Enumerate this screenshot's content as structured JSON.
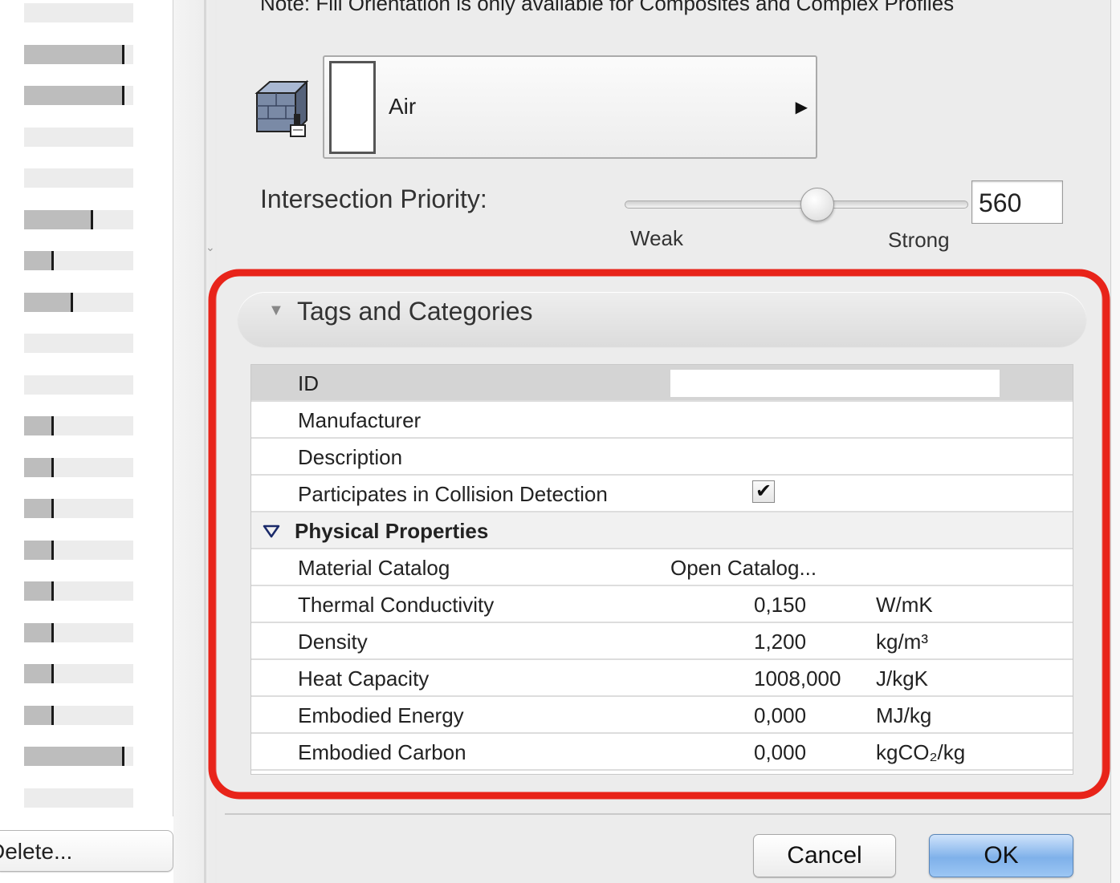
{
  "note": {
    "text": "Note: Fill Orientation is only available for Composites and Complex Profiles"
  },
  "fill": {
    "icon": "surface-brush-icon",
    "name": "Air",
    "arrow": "▶"
  },
  "priority": {
    "label": "Intersection Priority:",
    "value": "560",
    "slider_fraction": 0.56,
    "weak_label": "Weak",
    "strong_label": "Strong"
  },
  "tags": {
    "title": "Tags and Categories",
    "rows": {
      "id": {
        "label": "ID",
        "value": ""
      },
      "manufacturer": {
        "label": "Manufacturer"
      },
      "description": {
        "label": "Description"
      },
      "collision": {
        "label": "Participates in Collision Detection",
        "checked": true,
        "check_glyph": "✔"
      }
    },
    "physical": {
      "title": "Physical Properties",
      "catalog": {
        "label": "Material Catalog",
        "link": "Open Catalog..."
      },
      "thermal": {
        "label": "Thermal Conductivity",
        "value": "0,150",
        "unit": "W/mK"
      },
      "density": {
        "label": "Density",
        "value": "1,200",
        "unit": "kg/m³"
      },
      "heat": {
        "label": "Heat Capacity",
        "value": "1008,000",
        "unit": "J/kgK"
      },
      "energy": {
        "label": "Embodied Energy",
        "value": "0,000",
        "unit": "MJ/kg"
      },
      "carbon": {
        "label": "Embodied Carbon",
        "value": "0,000",
        "unit": "kgCO₂/kg"
      }
    }
  },
  "left_list": {
    "fill_fractions": [
      0,
      0.92,
      0.92,
      0,
      0,
      0.63,
      0.27,
      0.45,
      0,
      0,
      0.27,
      0.27,
      0.27,
      0.27,
      0.27,
      0.27,
      0.27,
      0.27,
      0.92,
      0
    ],
    "delete_label": "Delete..."
  },
  "footer": {
    "cancel_label": "Cancel",
    "ok_label": "OK"
  },
  "colors": {
    "annotation_red": "#e8241a",
    "ok_blue": "#7fb1ea"
  }
}
